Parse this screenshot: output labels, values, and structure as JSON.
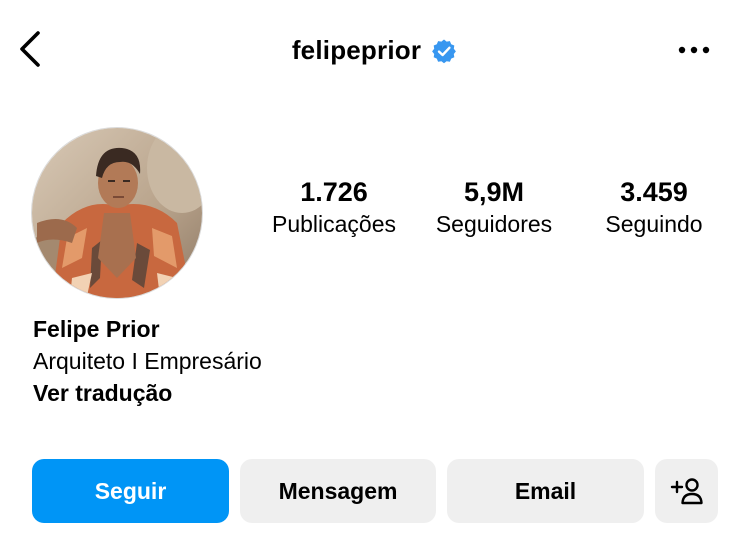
{
  "header": {
    "username": "felipeprior",
    "verified": true,
    "back_icon": "chevron-left-icon",
    "more_icon": "more-horizontal-icon"
  },
  "stats": [
    {
      "value": "1.726",
      "label": "Publicações"
    },
    {
      "value": "5,9M",
      "label": "Seguidores"
    },
    {
      "value": "3.459",
      "label": "Seguindo"
    }
  ],
  "bio": {
    "name": "Felipe Prior",
    "description": "Arquiteto I Empresário",
    "translate_link": "Ver tradução"
  },
  "actions": {
    "follow_label": "Seguir",
    "message_label": "Mensagem",
    "email_label": "Email",
    "suggest_icon": "add-person-icon"
  },
  "colors": {
    "accent": "#0095f6",
    "verified_badge": "#3897f0",
    "secondary_button": "#efefef"
  }
}
